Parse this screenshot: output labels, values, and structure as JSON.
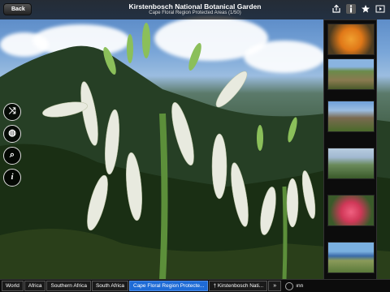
{
  "header": {
    "back_label": "Back",
    "title": "Kirstenbosch National Botanical Garden",
    "subtitle": "Cape Floral Region Protected Areas (1/50)"
  },
  "top_icons": [
    "share-icon",
    "info-icon",
    "favorite-star-icon",
    "slideshow-icon"
  ],
  "side_buttons": [
    "shuffle-icon",
    "globe-icon",
    "search-icon",
    "info-icon"
  ],
  "side_button_glyphs": {
    "shuffle": "⤨",
    "globe": "◍",
    "search": "⌕",
    "info": "i"
  },
  "thumbnails": [
    {
      "subject": "orange protea flower",
      "selected": false
    },
    {
      "subject": "green mountain slope",
      "selected": false
    },
    {
      "subject": "rocky peak landscape",
      "selected": false
    },
    {
      "subject": "coastal hills",
      "selected": false
    },
    {
      "subject": "pink protea flower",
      "selected": false
    },
    {
      "subject": "coastline with sea",
      "selected": false
    }
  ],
  "breadcrumbs": [
    {
      "label": "World",
      "active": false
    },
    {
      "label": "Africa",
      "active": false
    },
    {
      "label": "Southern Africa",
      "active": false
    },
    {
      "label": "South Africa",
      "active": false
    },
    {
      "label": "Cape Floral Region Protecte...",
      "active": true
    },
    {
      "label": "† Kirstenbosch Nati...",
      "active": false
    }
  ],
  "more_label": "»",
  "trailing_text": "ınn"
}
